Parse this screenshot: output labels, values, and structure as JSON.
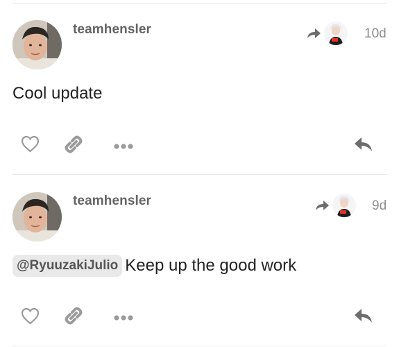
{
  "posts": [
    {
      "username": "teamhensler",
      "date": "10d",
      "body_text": "Cool update",
      "mention": ""
    },
    {
      "username": "teamhensler",
      "date": "9d",
      "body_text": "Keep up the good work",
      "mention": "@RyuuzakiJulio"
    }
  ],
  "icons": {
    "like": "heart-icon",
    "share": "link-icon",
    "more": "more-icon",
    "reply": "reply-icon",
    "reply_to": "reply-to-arrow-icon"
  },
  "colors": {
    "icon_gray": "#9b9b9b",
    "dark_icon": "#6c6c6c",
    "mention_bg": "#e9e9e9"
  }
}
